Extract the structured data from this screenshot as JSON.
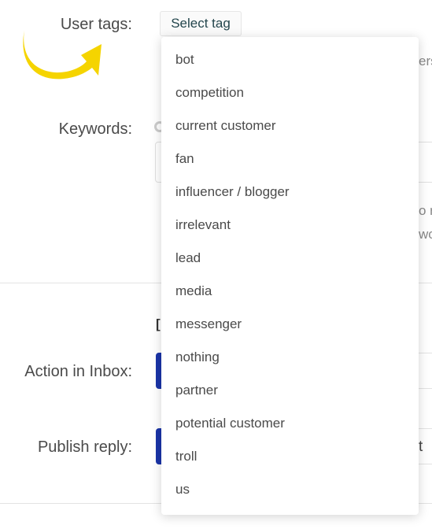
{
  "form": {
    "user_tags_label": "User tags:",
    "keywords_label": "Keywords:",
    "action_in_inbox_label": "Action in Inbox:",
    "publish_reply_label": "Publish reply:",
    "select_tag_button": "Select tag"
  },
  "background_fragments": {
    "users_partial": "ers",
    "hint_partial_1": "o r",
    "hint_partial_2": "wo",
    "section_header_partial": "[",
    "publish_partial": "t"
  },
  "dropdown": {
    "items": [
      "bot",
      "competition",
      "current customer",
      "fan",
      "influencer / blogger",
      "irrelevant",
      "lead",
      "media",
      "messenger",
      "nothing",
      "partner",
      "potential customer",
      "troll",
      "us"
    ]
  },
  "colors": {
    "arrow": "#f5d400",
    "primary_button": "#1a34a8",
    "select_tag_text": "#24464d"
  }
}
